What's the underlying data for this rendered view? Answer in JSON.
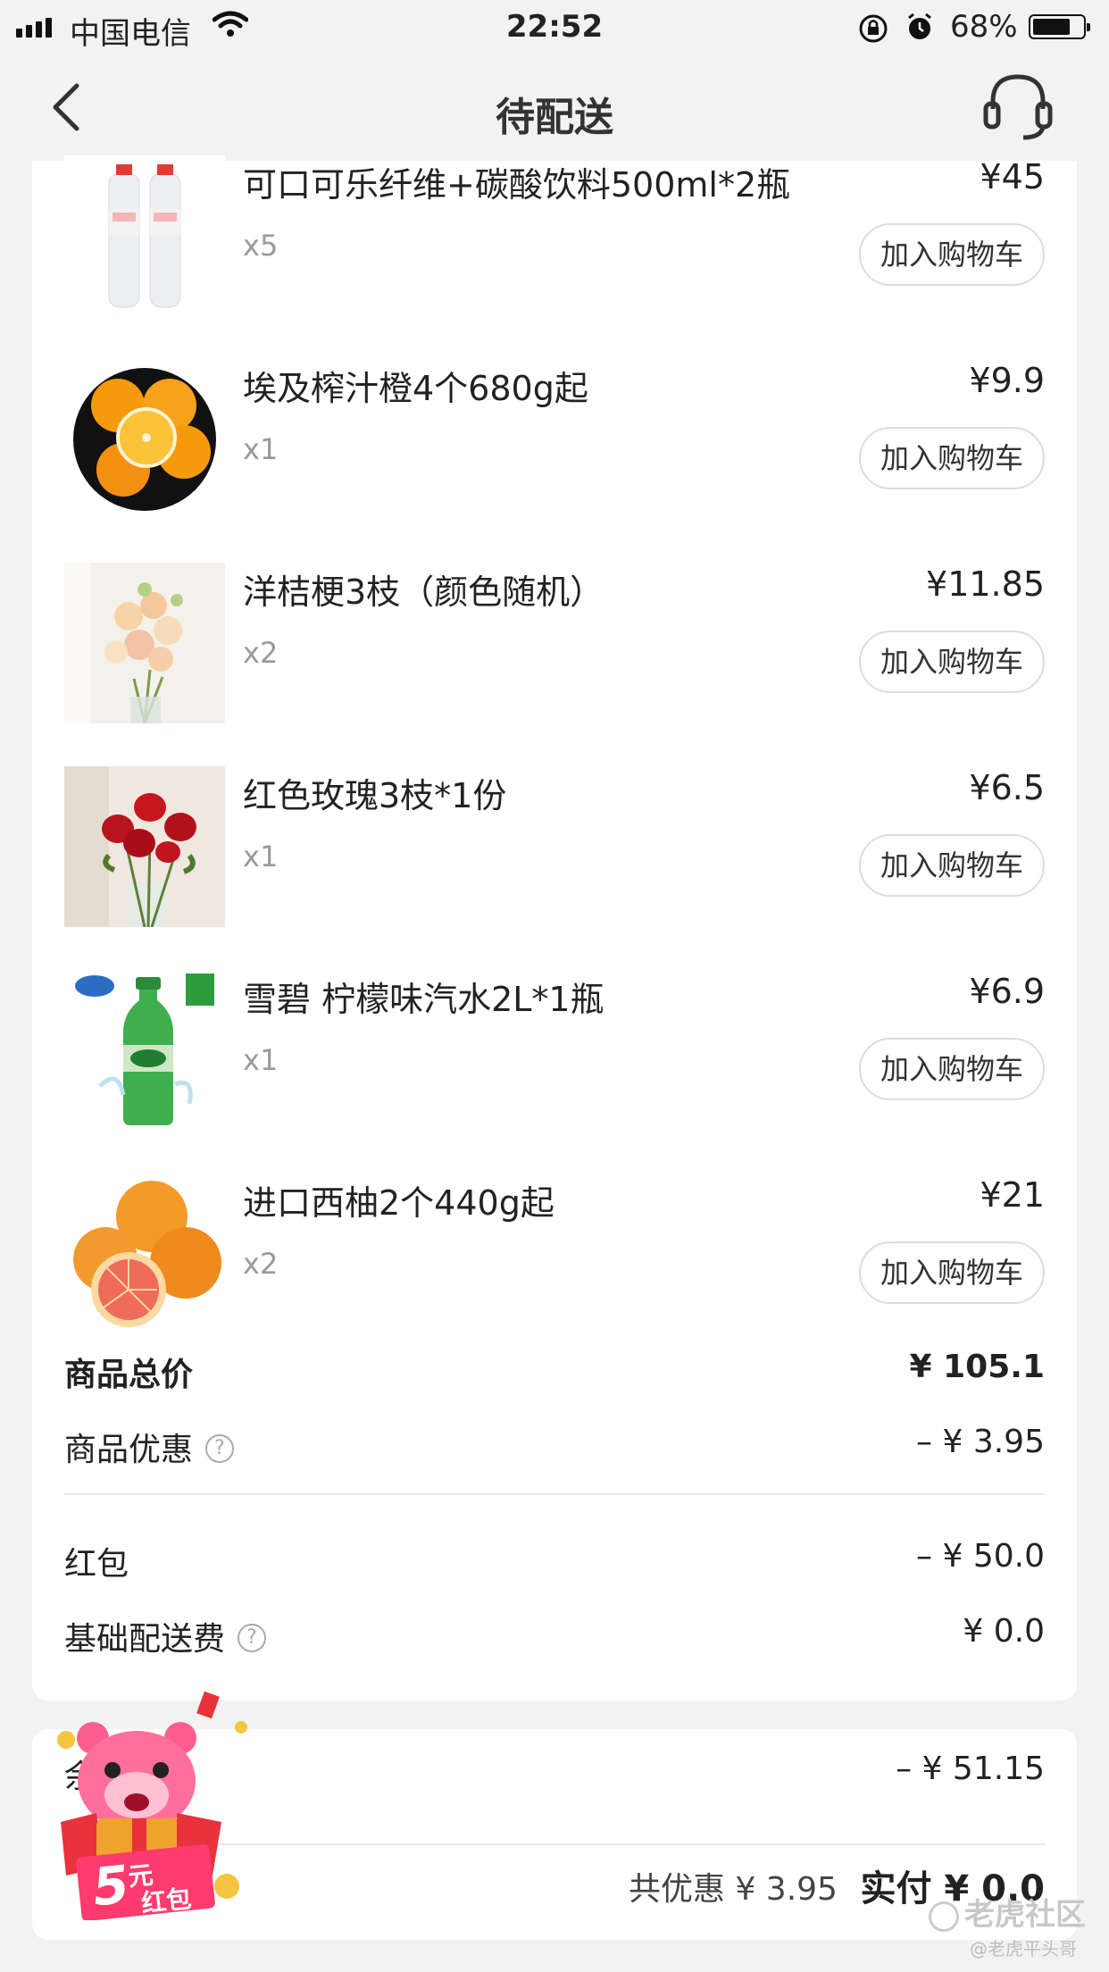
{
  "status_bar": {
    "carrier": "中国电信",
    "time": "22:52",
    "battery": "68%"
  },
  "nav": {
    "title": "待配送"
  },
  "cart_button_label": "加入购物车",
  "items": [
    {
      "name": "可口可乐纤维+碳酸饮料500ml*2瓶",
      "qty": "x5",
      "price": "¥45"
    },
    {
      "name": "埃及榨汁橙4个680g起",
      "qty": "x1",
      "price": "¥9.9"
    },
    {
      "name": "洋桔梗3枝（颜色随机）",
      "qty": "x2",
      "price": "¥11.85"
    },
    {
      "name": "红色玫瑰3枝*1份",
      "qty": "x1",
      "price": "¥6.5"
    },
    {
      "name": "雪碧 柠檬味汽水2L*1瓶",
      "qty": "x1",
      "price": "¥6.9"
    },
    {
      "name": "进口西柚2个440g起",
      "qty": "x2",
      "price": "¥21"
    }
  ],
  "summary": {
    "total_label": "商品总价",
    "total_value": "¥ 105.1",
    "discount_label": "商品优惠",
    "discount_value": "– ¥ 3.95",
    "redpacket_label": "红包",
    "redpacket_value": "– ¥ 50.0",
    "delivery_label": "基础配送费",
    "delivery_value": "¥ 0.0"
  },
  "payment": {
    "balance_label": "余",
    "balance_value": "– ¥ 51.15",
    "saved_text": "共优惠 ¥ 3.95",
    "paid_text": "实付 ¥ 0.0"
  },
  "promo": {
    "amount": "5",
    "unit": "元",
    "label": "红包"
  },
  "watermark": {
    "brand": "老虎社区",
    "user": "@老虎平头哥"
  },
  "colors": {
    "background": "#f2f2f2",
    "card": "#ffffff",
    "promo_red": "#e8323c",
    "promo_pink": "#ff5d8f"
  }
}
